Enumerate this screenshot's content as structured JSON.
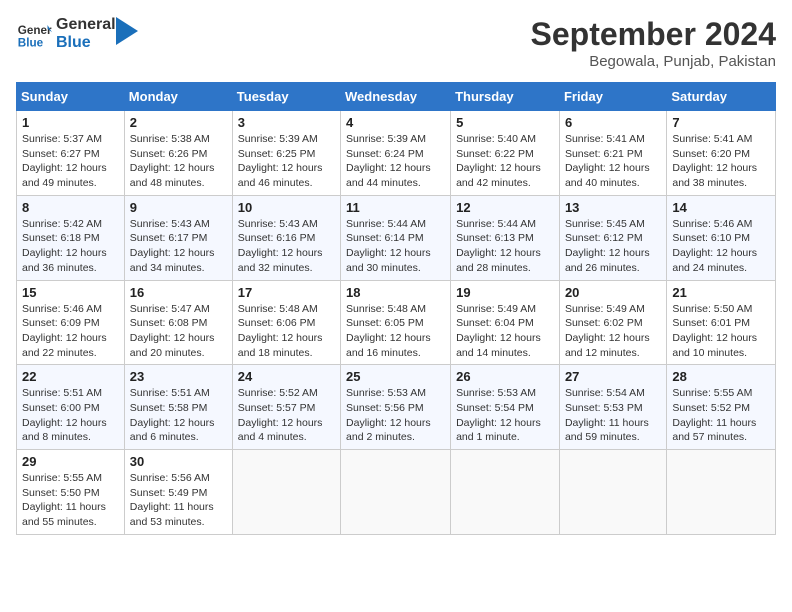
{
  "header": {
    "logo_general": "General",
    "logo_blue": "Blue",
    "month_title": "September 2024",
    "location": "Begowala, Punjab, Pakistan"
  },
  "days_of_week": [
    "Sunday",
    "Monday",
    "Tuesday",
    "Wednesday",
    "Thursday",
    "Friday",
    "Saturday"
  ],
  "weeks": [
    [
      {
        "day": "1",
        "sunrise": "5:37 AM",
        "sunset": "6:27 PM",
        "daylight": "12 hours and 49 minutes."
      },
      {
        "day": "2",
        "sunrise": "5:38 AM",
        "sunset": "6:26 PM",
        "daylight": "12 hours and 48 minutes."
      },
      {
        "day": "3",
        "sunrise": "5:39 AM",
        "sunset": "6:25 PM",
        "daylight": "12 hours and 46 minutes."
      },
      {
        "day": "4",
        "sunrise": "5:39 AM",
        "sunset": "6:24 PM",
        "daylight": "12 hours and 44 minutes."
      },
      {
        "day": "5",
        "sunrise": "5:40 AM",
        "sunset": "6:22 PM",
        "daylight": "12 hours and 42 minutes."
      },
      {
        "day": "6",
        "sunrise": "5:41 AM",
        "sunset": "6:21 PM",
        "daylight": "12 hours and 40 minutes."
      },
      {
        "day": "7",
        "sunrise": "5:41 AM",
        "sunset": "6:20 PM",
        "daylight": "12 hours and 38 minutes."
      }
    ],
    [
      {
        "day": "8",
        "sunrise": "5:42 AM",
        "sunset": "6:18 PM",
        "daylight": "12 hours and 36 minutes."
      },
      {
        "day": "9",
        "sunrise": "5:43 AM",
        "sunset": "6:17 PM",
        "daylight": "12 hours and 34 minutes."
      },
      {
        "day": "10",
        "sunrise": "5:43 AM",
        "sunset": "6:16 PM",
        "daylight": "12 hours and 32 minutes."
      },
      {
        "day": "11",
        "sunrise": "5:44 AM",
        "sunset": "6:14 PM",
        "daylight": "12 hours and 30 minutes."
      },
      {
        "day": "12",
        "sunrise": "5:44 AM",
        "sunset": "6:13 PM",
        "daylight": "12 hours and 28 minutes."
      },
      {
        "day": "13",
        "sunrise": "5:45 AM",
        "sunset": "6:12 PM",
        "daylight": "12 hours and 26 minutes."
      },
      {
        "day": "14",
        "sunrise": "5:46 AM",
        "sunset": "6:10 PM",
        "daylight": "12 hours and 24 minutes."
      }
    ],
    [
      {
        "day": "15",
        "sunrise": "5:46 AM",
        "sunset": "6:09 PM",
        "daylight": "12 hours and 22 minutes."
      },
      {
        "day": "16",
        "sunrise": "5:47 AM",
        "sunset": "6:08 PM",
        "daylight": "12 hours and 20 minutes."
      },
      {
        "day": "17",
        "sunrise": "5:48 AM",
        "sunset": "6:06 PM",
        "daylight": "12 hours and 18 minutes."
      },
      {
        "day": "18",
        "sunrise": "5:48 AM",
        "sunset": "6:05 PM",
        "daylight": "12 hours and 16 minutes."
      },
      {
        "day": "19",
        "sunrise": "5:49 AM",
        "sunset": "6:04 PM",
        "daylight": "12 hours and 14 minutes."
      },
      {
        "day": "20",
        "sunrise": "5:49 AM",
        "sunset": "6:02 PM",
        "daylight": "12 hours and 12 minutes."
      },
      {
        "day": "21",
        "sunrise": "5:50 AM",
        "sunset": "6:01 PM",
        "daylight": "12 hours and 10 minutes."
      }
    ],
    [
      {
        "day": "22",
        "sunrise": "5:51 AM",
        "sunset": "6:00 PM",
        "daylight": "12 hours and 8 minutes."
      },
      {
        "day": "23",
        "sunrise": "5:51 AM",
        "sunset": "5:58 PM",
        "daylight": "12 hours and 6 minutes."
      },
      {
        "day": "24",
        "sunrise": "5:52 AM",
        "sunset": "5:57 PM",
        "daylight": "12 hours and 4 minutes."
      },
      {
        "day": "25",
        "sunrise": "5:53 AM",
        "sunset": "5:56 PM",
        "daylight": "12 hours and 2 minutes."
      },
      {
        "day": "26",
        "sunrise": "5:53 AM",
        "sunset": "5:54 PM",
        "daylight": "12 hours and 1 minute."
      },
      {
        "day": "27",
        "sunrise": "5:54 AM",
        "sunset": "5:53 PM",
        "daylight": "11 hours and 59 minutes."
      },
      {
        "day": "28",
        "sunrise": "5:55 AM",
        "sunset": "5:52 PM",
        "daylight": "11 hours and 57 minutes."
      }
    ],
    [
      {
        "day": "29",
        "sunrise": "5:55 AM",
        "sunset": "5:50 PM",
        "daylight": "11 hours and 55 minutes."
      },
      {
        "day": "30",
        "sunrise": "5:56 AM",
        "sunset": "5:49 PM",
        "daylight": "11 hours and 53 minutes."
      },
      null,
      null,
      null,
      null,
      null
    ]
  ]
}
